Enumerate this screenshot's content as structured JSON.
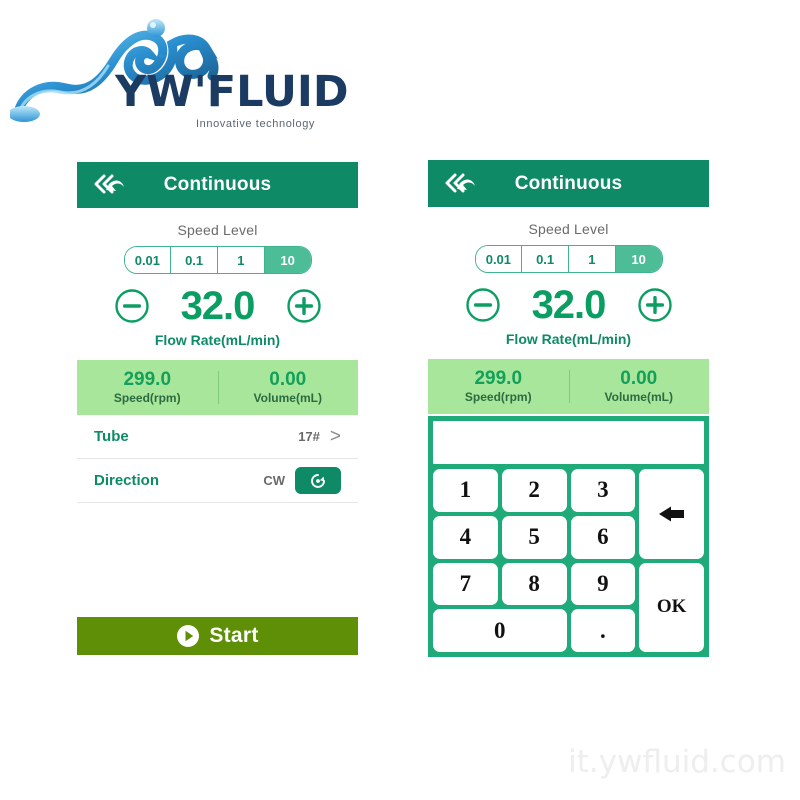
{
  "logo": {
    "wordmark": "YW'FLUID",
    "tagline": "Innovative technology",
    "icon": "water-splash-icon"
  },
  "colors": {
    "header_teal": "#0e8b66",
    "accent_green": "#0b9e62",
    "stats_bg": "#a8e69c",
    "start_olive": "#5e8f06",
    "keypad_bg": "#1faa7a",
    "segment_active": "#4cbd96"
  },
  "left_panel": {
    "header": {
      "title": "Continuous",
      "back_icon": "back-double-arrow-icon"
    },
    "speed_level": {
      "label": "Speed Level",
      "options": [
        "0.01",
        "0.1",
        "1",
        "10"
      ],
      "selected": "10"
    },
    "flow_rate": {
      "decrement_icon": "minus-circle-icon",
      "increment_icon": "plus-circle-icon",
      "value": "32.0",
      "caption": "Flow Rate(mL/min)"
    },
    "stats": [
      {
        "value": "299.0",
        "caption": "Speed(rpm)"
      },
      {
        "value": "0.00",
        "caption": "Volume(mL)"
      }
    ],
    "rows": [
      {
        "label": "Tube",
        "value": "17#",
        "chevron": ">"
      },
      {
        "label": "Direction",
        "value": "CW",
        "icon": "clockwise-rotation-icon"
      }
    ],
    "start": {
      "label": "Start",
      "icon": "play-circle-icon"
    }
  },
  "right_panel": {
    "header": {
      "title": "Continuous",
      "back_icon": "back-double-arrow-icon"
    },
    "speed_level": {
      "label": "Speed Level",
      "options": [
        "0.01",
        "0.1",
        "1",
        "10"
      ],
      "selected": "10"
    },
    "flow_rate": {
      "decrement_icon": "minus-circle-icon",
      "increment_icon": "plus-circle-icon",
      "value": "32.0",
      "caption": "Flow Rate(mL/min)"
    },
    "stats": [
      {
        "value": "299.0",
        "caption": "Speed(rpm)"
      },
      {
        "value": "0.00",
        "caption": "Volume(mL)"
      }
    ],
    "keypad": {
      "display_value": "",
      "keys": {
        "k1": "1",
        "k2": "2",
        "k3": "3",
        "k4": "4",
        "k5": "5",
        "k6": "6",
        "k7": "7",
        "k8": "8",
        "k9": "9",
        "k0": "0",
        "dot": ".",
        "ok": "OK",
        "backspace_icon": "backspace-arrow-icon"
      }
    }
  },
  "watermark": "it.ywfluid.com"
}
